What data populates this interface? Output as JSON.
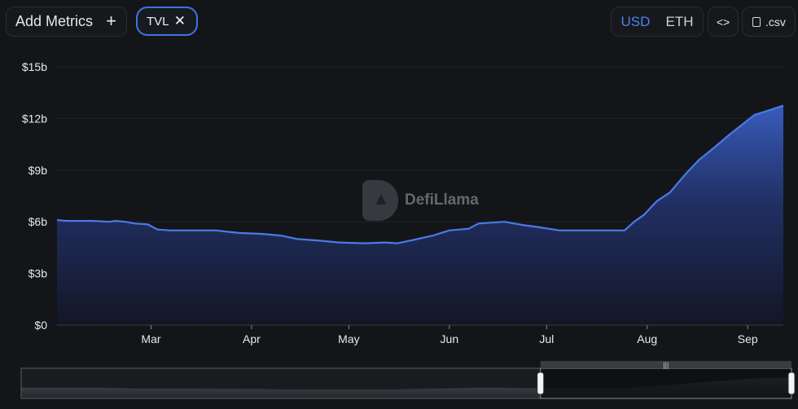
{
  "toolbar": {
    "add_metrics_label": "Add Metrics",
    "add_metrics_icon": "plus-icon",
    "metric_chip_label": "TVL",
    "metric_chip_remove_icon": "close-icon",
    "currency_options": [
      "USD",
      "ETH"
    ],
    "currency_selected": "USD",
    "embed_label": "<>",
    "csv_label": ".csv"
  },
  "watermark": {
    "text": "DefiLlama"
  },
  "colors": {
    "accent": "#3d73e6",
    "line": "#4a7ae6",
    "background": "#141518"
  },
  "chart_data": {
    "type": "area",
    "series": [
      {
        "values": [
          [
            "2024-02-01",
            6.1
          ],
          [
            "2024-02-04",
            6.05
          ],
          [
            "2024-02-12",
            6.05
          ],
          [
            "2024-02-17",
            6.0
          ],
          [
            "2024-02-19",
            6.05
          ],
          [
            "2024-02-22",
            6.0
          ],
          [
            "2024-02-25",
            5.9
          ],
          [
            "2024-02-29",
            5.85
          ],
          [
            "2024-03-03",
            5.55
          ],
          [
            "2024-03-07",
            5.5
          ],
          [
            "2024-03-14",
            5.5
          ],
          [
            "2024-03-21",
            5.5
          ],
          [
            "2024-03-28",
            5.35
          ],
          [
            "2024-04-04",
            5.3
          ],
          [
            "2024-04-10",
            5.2
          ],
          [
            "2024-04-15",
            5.0
          ],
          [
            "2024-04-22",
            4.9
          ],
          [
            "2024-04-28",
            4.8
          ],
          [
            "2024-05-06",
            4.75
          ],
          [
            "2024-05-12",
            4.8
          ],
          [
            "2024-05-16",
            4.75
          ],
          [
            "2024-05-21",
            4.95
          ],
          [
            "2024-05-27",
            5.2
          ],
          [
            "2024-06-01",
            5.5
          ],
          [
            "2024-06-07",
            5.6
          ],
          [
            "2024-06-10",
            5.9
          ],
          [
            "2024-06-18",
            6.0
          ],
          [
            "2024-06-24",
            5.8
          ],
          [
            "2024-06-28",
            5.7
          ],
          [
            "2024-07-05",
            5.5
          ],
          [
            "2024-07-19",
            5.5
          ],
          [
            "2024-07-25",
            5.5
          ],
          [
            "2024-07-28",
            6.0
          ],
          [
            "2024-07-31",
            6.4
          ],
          [
            "2024-08-04",
            7.2
          ],
          [
            "2024-08-08",
            7.7
          ],
          [
            "2024-08-13",
            8.8
          ],
          [
            "2024-08-17",
            9.6
          ],
          [
            "2024-08-21",
            10.2
          ],
          [
            "2024-08-26",
            11.0
          ],
          [
            "2024-08-30",
            11.6
          ],
          [
            "2024-09-03",
            12.2
          ],
          [
            "2024-09-08",
            12.5
          ],
          [
            "2024-09-12",
            12.75
          ]
        ]
      }
    ],
    "x_ticks": [
      "Mar",
      "Apr",
      "May",
      "Jun",
      "Jul",
      "Aug",
      "Sep"
    ],
    "x_tick_dates": [
      "2024-03-01",
      "2024-04-01",
      "2024-05-01",
      "2024-06-01",
      "2024-07-01",
      "2024-08-01",
      "2024-09-01"
    ],
    "xlim": [
      "2024-02-01",
      "2024-09-12"
    ],
    "y_ticks": [
      "$0",
      "$3b",
      "$6b",
      "$9b",
      "$12b",
      "$15b"
    ],
    "y_tick_values": [
      0,
      3,
      6,
      9,
      12,
      15
    ],
    "ylim": [
      0,
      15
    ],
    "y_unit": "billions USD",
    "grid": "horizontal",
    "legend": "none",
    "brush_range": [
      "2024-07-01",
      "2024-09-12"
    ]
  }
}
